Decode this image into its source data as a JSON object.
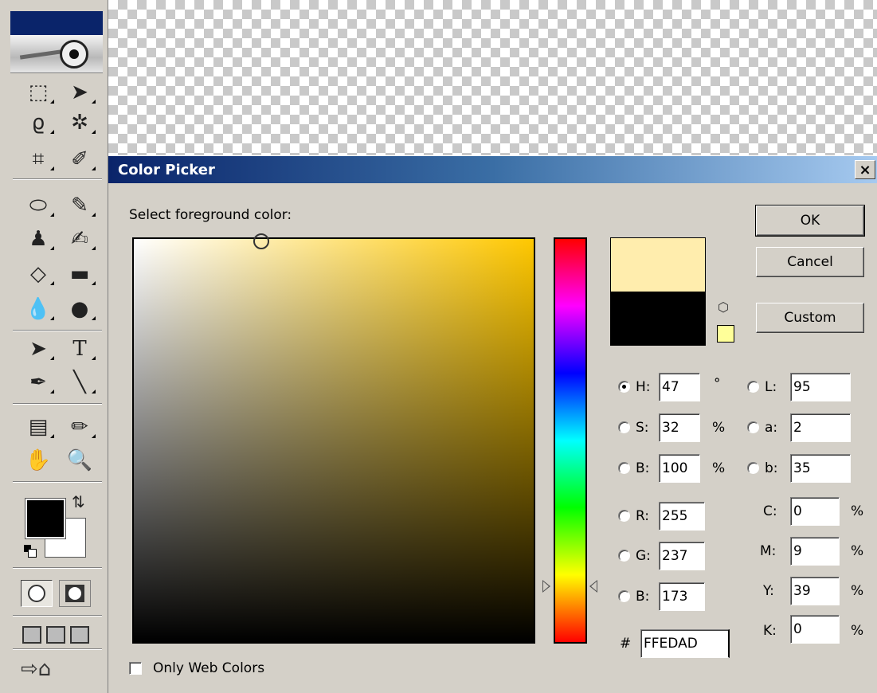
{
  "dialog": {
    "title": "Color Picker",
    "close_glyph": "×",
    "prompt": "Select foreground color:"
  },
  "buttons": {
    "ok": "OK",
    "cancel": "Cancel",
    "custom": "Custom"
  },
  "hsb": {
    "h": {
      "label": "H:",
      "value": "47",
      "unit": "°",
      "selected": true
    },
    "s": {
      "label": "S:",
      "value": "32",
      "unit": "%"
    },
    "b": {
      "label": "B:",
      "value": "100",
      "unit": "%"
    }
  },
  "lab": {
    "l": {
      "label": "L:",
      "value": "95"
    },
    "a": {
      "label": "a:",
      "value": "2"
    },
    "b": {
      "label": "b:",
      "value": "35"
    }
  },
  "rgb": {
    "r": {
      "label": "R:",
      "value": "255"
    },
    "g": {
      "label": "G:",
      "value": "237"
    },
    "b": {
      "label": "B:",
      "value": "173"
    }
  },
  "cmyk": {
    "c": {
      "label": "C:",
      "value": "0",
      "unit": "%"
    },
    "m": {
      "label": "M:",
      "value": "9",
      "unit": "%"
    },
    "y": {
      "label": "Y:",
      "value": "39",
      "unit": "%"
    },
    "k": {
      "label": "K:",
      "value": "0",
      "unit": "%"
    }
  },
  "hex": {
    "label": "#",
    "value": "FFEDAD"
  },
  "only_web_colors": {
    "label": "Only Web Colors",
    "checked": false
  },
  "colors": {
    "new_color": "#ffedad",
    "current_color": "#000000",
    "web_safe_swatch": "#ffff99",
    "title_bar_start": "#0a246a",
    "title_bar_end": "#a6caf0"
  },
  "toolbox": {
    "tools": [
      "marquee-icon",
      "move-icon",
      "lasso-icon",
      "magic-wand-icon",
      "crop-icon",
      "slice-icon",
      "healing-brush-icon",
      "brush-icon",
      "clone-stamp-icon",
      "history-brush-icon",
      "eraser-icon",
      "gradient-icon",
      "blur-icon",
      "dodge-icon",
      "path-selection-icon",
      "type-icon",
      "pen-icon",
      "line-icon",
      "notes-icon",
      "eyedropper-icon",
      "hand-icon",
      "zoom-icon"
    ],
    "type_glyph": "T"
  }
}
